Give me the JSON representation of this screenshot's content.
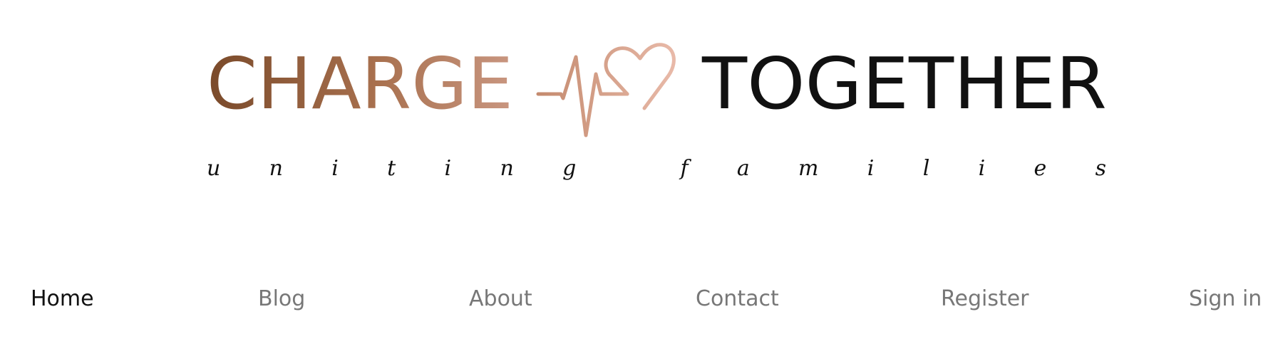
{
  "logo": {
    "brand_word_1": "CHARGE",
    "brand_word_2": "TOGETHER",
    "tagline": "uniting families",
    "icon": "heartbeat-heart-icon",
    "colors": {
      "copper_dark": "#7a4a2a",
      "copper_mid": "#b47a5c",
      "copper_light": "#e4b2a0",
      "text_dark": "#111111"
    }
  },
  "nav": {
    "items": [
      {
        "label": "Home",
        "active": true
      },
      {
        "label": "Blog",
        "active": false
      },
      {
        "label": "About",
        "active": false
      },
      {
        "label": "Contact",
        "active": false
      },
      {
        "label": "Register",
        "active": false
      },
      {
        "label": "Sign in",
        "active": false
      }
    ],
    "colors": {
      "active": "#111111",
      "inactive": "#777777"
    }
  }
}
